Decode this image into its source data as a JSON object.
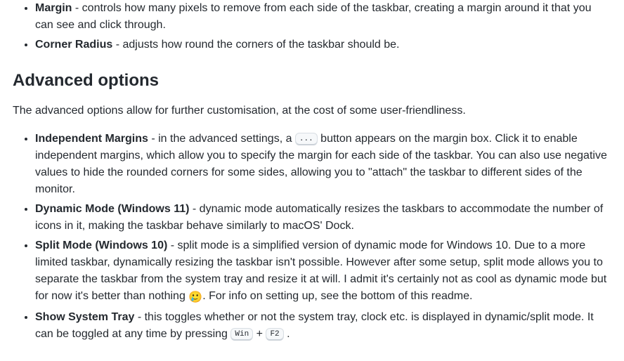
{
  "section1": {
    "items": [
      {
        "term": "Margin",
        "desc": " - controls how many pixels to remove from each side of the taskbar, creating a margin around it that you can see and click through."
      },
      {
        "term": "Corner Radius",
        "desc": " - adjusts how round the corners of the taskbar should be."
      }
    ]
  },
  "advanced": {
    "heading": "Advanced options",
    "intro": "The advanced options allow for further customisation, at the cost of some user-friendliness.",
    "items": [
      {
        "term": "Independent Margins",
        "desc_pre": " - in the advanced settings, a ",
        "kbd": "...",
        "desc_post": " button appears on the margin box. Click it to enable independent margins, which allow you to specify the margin for each side of the taskbar. You can also use negative values to hide the rounded corners for some sides, allowing you to \"attach\" the taskbar to different sides of the monitor."
      },
      {
        "term": "Dynamic Mode (Windows 11)",
        "desc": " - dynamic mode automatically resizes the taskbars to accommodate the number of icons in it, making the taskbar behave similarly to macOS' Dock."
      },
      {
        "term": "Split Mode (Windows 10)",
        "desc_pre": " - split mode is a simplified version of dynamic mode for Windows 10. Due to a more limited taskbar, dynamically resizing the taskbar isn't possible. However after some setup, split mode allows you to separate the taskbar from the system tray and resize it at will. I admit it's certainly not as cool as dynamic mode but for now it's better than nothing ",
        "emoji": "🥲",
        "desc_post": ". For info on setting up, see the bottom of this readme."
      },
      {
        "term": "Show System Tray",
        "desc_pre": " - this toggles whether or not the system tray, clock etc. is displayed in dynamic/split mode. It can be toggled at any time by pressing ",
        "kbd1": "Win",
        "plus": " + ",
        "kbd2": "F2",
        "tail": " ."
      }
    ]
  }
}
